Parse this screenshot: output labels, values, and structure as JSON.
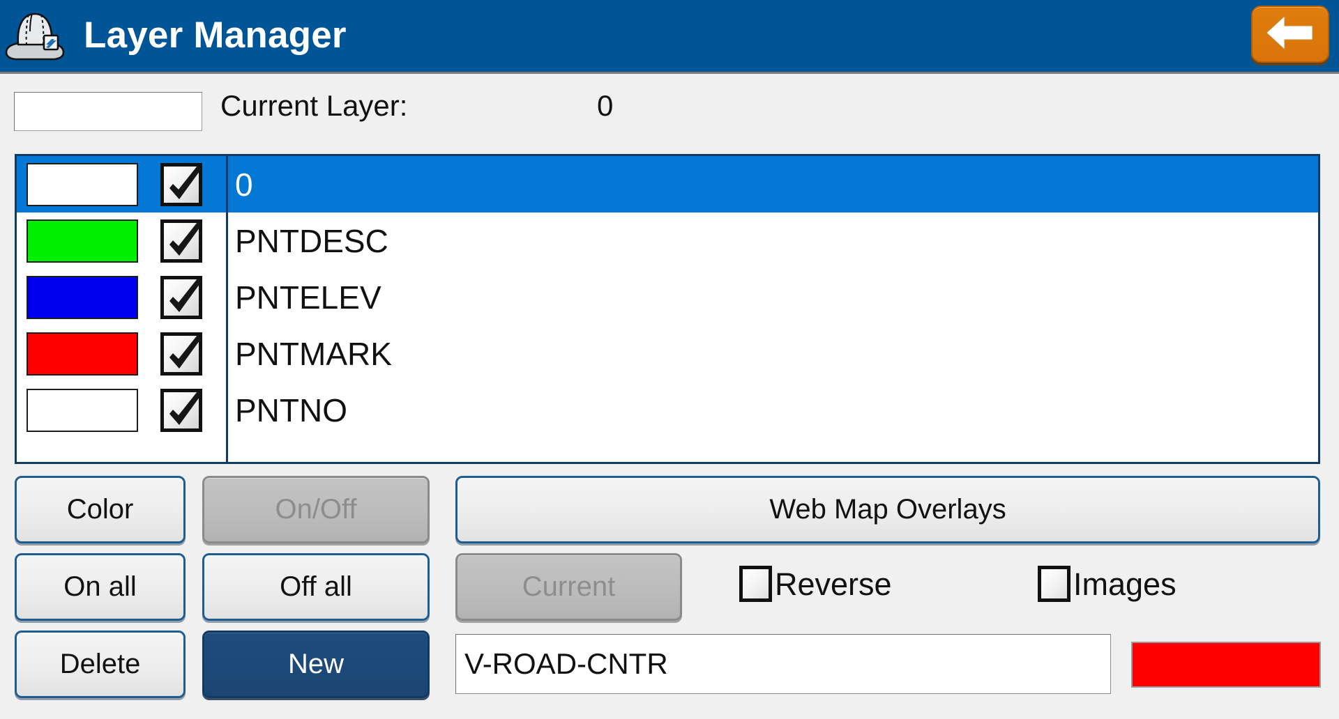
{
  "titlebar": {
    "title": "Layer Manager",
    "logo_icon": "hard-hat-icon",
    "back_icon": "arrow-left-icon",
    "background_color": "#005596",
    "back_button_color": "#d9740a"
  },
  "current_layer": {
    "label": "Current Layer:",
    "value": "0",
    "swatch_color": "#ffffff"
  },
  "layer_list": {
    "selected_index": 0,
    "selection_color": "#0478d4",
    "check_icon": "check-mark-icon",
    "rows": [
      {
        "name": "0",
        "color": "#ffffff",
        "visible": true
      },
      {
        "name": "PNTDESC",
        "color": "#00ee00",
        "visible": true
      },
      {
        "name": "PNTELEV",
        "color": "#0000ee",
        "visible": true
      },
      {
        "name": "PNTMARK",
        "color": "#ff0000",
        "visible": true
      },
      {
        "name": "PNTNO",
        "color": "#ffffff",
        "visible": true
      }
    ]
  },
  "buttons": {
    "color": "Color",
    "onoff": "On/Off",
    "webmap": "Web Map Overlays",
    "onall": "On all",
    "offall": "Off all",
    "current": "Current",
    "delete": "Delete",
    "new": "New"
  },
  "options": {
    "reverse": {
      "label": "Reverse",
      "checked": false
    },
    "images": {
      "label": "Images",
      "checked": false
    }
  },
  "new_layer": {
    "name_value": "V-ROAD-CNTR",
    "name_placeholder": "",
    "color": "#ff0000"
  }
}
